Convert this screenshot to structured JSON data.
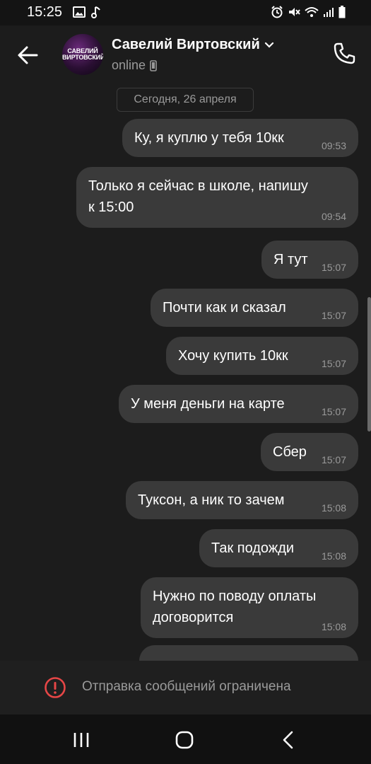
{
  "status_bar": {
    "time": "15:25"
  },
  "header": {
    "avatar_text_line1": "САВЕЛИЙ",
    "avatar_text_line2": "ВИРТОВСКИЙ",
    "contact_name": "Савелий Виртовский",
    "status": "online"
  },
  "date_separator": "Сегодня, 26 апреля",
  "messages": [
    {
      "text": "Ку, я куплю у тебя 10кк",
      "time": "09:53"
    },
    {
      "text_lines": [
        "Только я сейчас в школе, напишу",
        "к 15:00"
      ],
      "time": "09:54"
    },
    {
      "text": "Я тут",
      "time": "15:07"
    },
    {
      "text": "Почти как и сказал",
      "time": "15:07"
    },
    {
      "text": "Хочу купить 10кк",
      "time": "15:07"
    },
    {
      "text": "У меня деньги на карте",
      "time": "15:07"
    },
    {
      "text": "Сбер",
      "time": "15:07"
    },
    {
      "text": "Туксон, а ник то зачем",
      "time": "15:08"
    },
    {
      "text": "Так подожди",
      "time": "15:08"
    },
    {
      "text_lines": [
        "Нужно по поводу оплаты",
        "договорится"
      ],
      "time": "15:08"
    }
  ],
  "restriction_notice": "Отправка сообщений ограничена",
  "colors": {
    "background": "#1c1c1c",
    "bubble": "#3a3a3a",
    "secondary_text": "#9a9a9a",
    "warning": "#e64646"
  },
  "icons": {
    "back": "arrow-left-icon",
    "call": "phone-icon",
    "device": "smartphone-icon",
    "dropdown": "chevron-down-icon",
    "warning": "exclamation-circle-icon"
  }
}
